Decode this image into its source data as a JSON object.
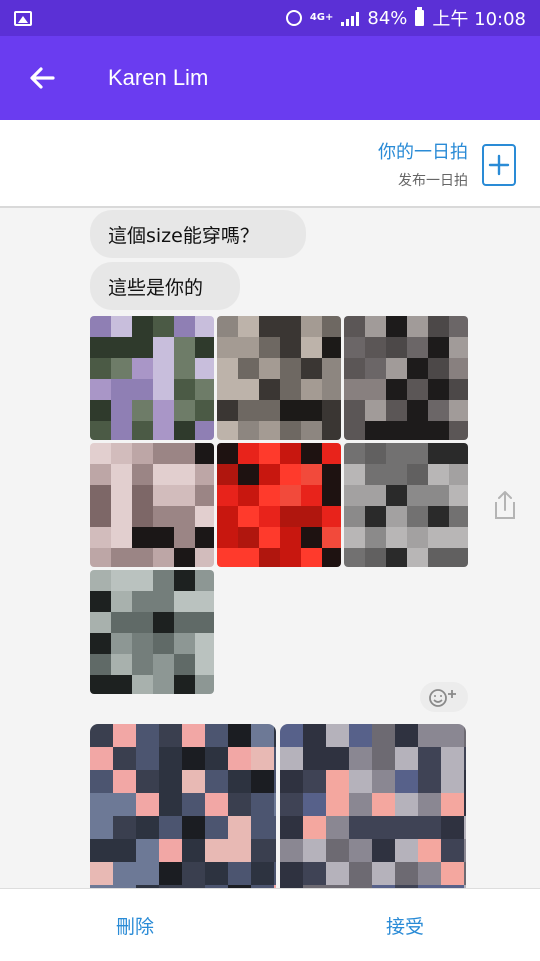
{
  "status_bar": {
    "network": "4G+",
    "battery": "84%",
    "time": "上午 10:08"
  },
  "header": {
    "contact_name": "Karen Lim",
    "back_icon": "arrow-left-icon"
  },
  "story_banner": {
    "title": "你的一日拍",
    "subtitle": "发布一日拍",
    "add_icon": "plus-box-icon"
  },
  "messages": [
    {
      "text": "這個size能穿嗎？"
    },
    {
      "text": "這些是你的"
    }
  ],
  "photos": [
    {
      "palette": [
        "#a996c7",
        "#8f7fb4",
        "#2f3a2c",
        "#4b5a45",
        "#6e7c68",
        "#c8bedc"
      ]
    },
    {
      "palette": [
        "#8d8680",
        "#a49b93",
        "#6e6862",
        "#3a3633",
        "#bdb3aa",
        "#1c1a18"
      ]
    },
    {
      "palette": [
        "#6b6667",
        "#88807f",
        "#4c4848",
        "#a19b99",
        "#1d1b1b",
        "#5b5656"
      ]
    },
    {
      "palette": [
        "#bda6a6",
        "#d2bcbc",
        "#9b8585",
        "#1b1717",
        "#e2cfcf",
        "#7d6767"
      ]
    },
    {
      "palette": [
        "#e8231b",
        "#ff3a2c",
        "#c8170f",
        "#1e1211",
        "#f24a3b",
        "#b0160e"
      ]
    },
    {
      "palette": [
        "#8b8a8a",
        "#a3a1a1",
        "#727171",
        "#2a2a2a",
        "#b8b6b6",
        "#616060"
      ]
    },
    {
      "palette": [
        "#8d9794",
        "#a8b1ad",
        "#747e7b",
        "#1d2120",
        "#bac2bf",
        "#606a67"
      ]
    }
  ],
  "wide_photos": [
    {
      "palette": [
        "#f2a7a5",
        "#2d3340",
        "#4c5570",
        "#1b1d22",
        "#6d7996",
        "#e8b9b4",
        "#3a3f4f"
      ]
    },
    {
      "palette": [
        "#f4a79f",
        "#6d6a72",
        "#8a8792",
        "#3f4355",
        "#b5b2bb",
        "#57618a",
        "#2f3240"
      ]
    }
  ],
  "icons": {
    "share": "share-icon",
    "reaction": "add-emoji-icon"
  },
  "actions": {
    "delete_label": "刪除",
    "accept_label": "接受"
  },
  "colors": {
    "status_bar": "#5b30d6",
    "app_bar": "#6a3cf0",
    "accent": "#2a8bd6",
    "bubble": "#e7e7e7"
  }
}
